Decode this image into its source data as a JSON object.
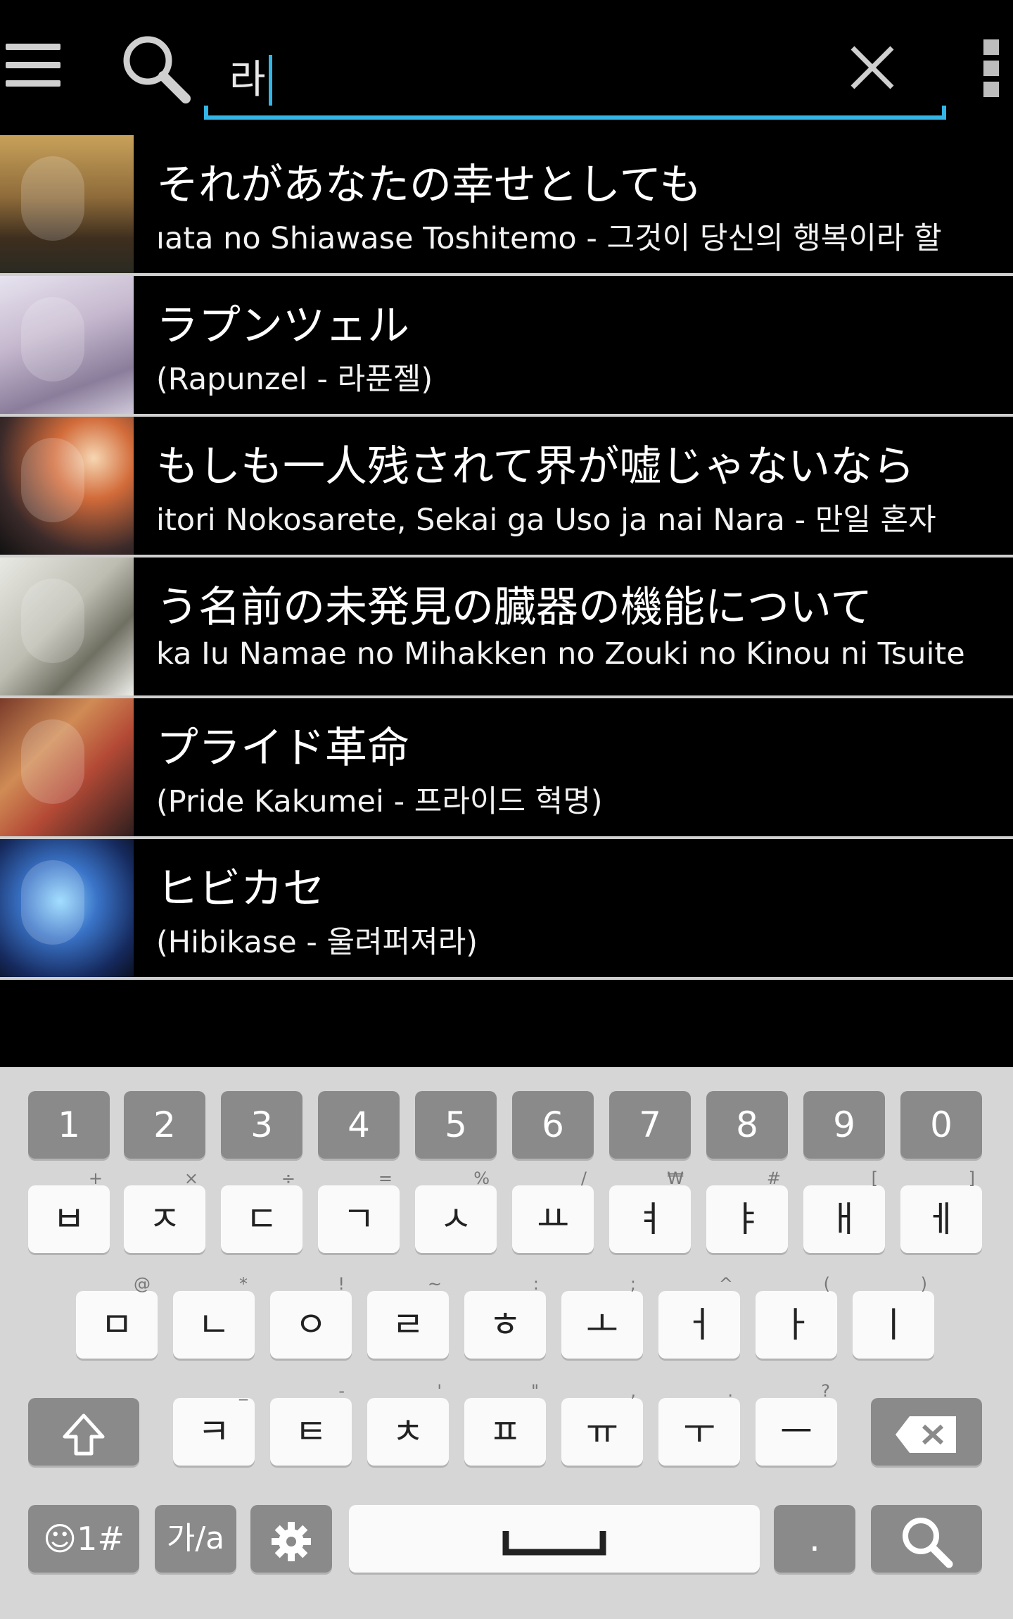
{
  "search": {
    "query": "라"
  },
  "results": [
    {
      "title": "それがあなたの幸せとしても",
      "subtitle": "ıata no Shiawase Toshitemo - 그것이 당신의 행복이라 할"
    },
    {
      "title": "ラプンツェル",
      "subtitle": "(Rapunzel - 라푼젤)"
    },
    {
      "title": "もしも一人残されて界が嘘じゃないなら",
      "subtitle": "itori Nokosarete, Sekai ga Uso ja nai Nara - 만일 혼자"
    },
    {
      "title": "う名前の未発見の臓器の機能について",
      "subtitle": "ka Iu Namae no Mihakken no Zouki no Kinou ni Tsuite"
    },
    {
      "title": "プライド革命",
      "subtitle": "(Pride Kakumei - 프라이드 혁명)"
    },
    {
      "title": "ヒビカセ",
      "subtitle": "(Hibikase - 울려퍼져라)"
    }
  ],
  "keyboard": {
    "numbers": [
      "1",
      "2",
      "3",
      "4",
      "5",
      "6",
      "7",
      "8",
      "9",
      "0"
    ],
    "row1": [
      {
        "label": "ㅂ",
        "hint": "+"
      },
      {
        "label": "ㅈ",
        "hint": "×"
      },
      {
        "label": "ㄷ",
        "hint": "÷"
      },
      {
        "label": "ㄱ",
        "hint": "="
      },
      {
        "label": "ㅅ",
        "hint": "%"
      },
      {
        "label": "ㅛ",
        "hint": "/"
      },
      {
        "label": "ㅕ",
        "hint": "₩"
      },
      {
        "label": "ㅑ",
        "hint": "#"
      },
      {
        "label": "ㅐ",
        "hint": "["
      },
      {
        "label": "ㅔ",
        "hint": "]"
      }
    ],
    "row2": [
      {
        "label": "ㅁ",
        "hint": "@"
      },
      {
        "label": "ㄴ",
        "hint": "*"
      },
      {
        "label": "ㅇ",
        "hint": "!"
      },
      {
        "label": "ㄹ",
        "hint": "~"
      },
      {
        "label": "ㅎ",
        "hint": ":"
      },
      {
        "label": "ㅗ",
        "hint": ";"
      },
      {
        "label": "ㅓ",
        "hint": "^"
      },
      {
        "label": "ㅏ",
        "hint": "("
      },
      {
        "label": "ㅣ",
        "hint": ")"
      }
    ],
    "row3": [
      {
        "label": "ㅋ",
        "hint": "_"
      },
      {
        "label": "ㅌ",
        "hint": "-"
      },
      {
        "label": "ㅊ",
        "hint": "'"
      },
      {
        "label": "ㅍ",
        "hint": "\""
      },
      {
        "label": "ㅠ",
        "hint": ","
      },
      {
        "label": "ㅜ",
        "hint": "."
      },
      {
        "label": "ㅡ",
        "hint": "?"
      }
    ],
    "symbols_label": "☺1#",
    "lang_label": "가/a",
    "period_label": ".",
    "accent_color": "#33b5e5"
  }
}
